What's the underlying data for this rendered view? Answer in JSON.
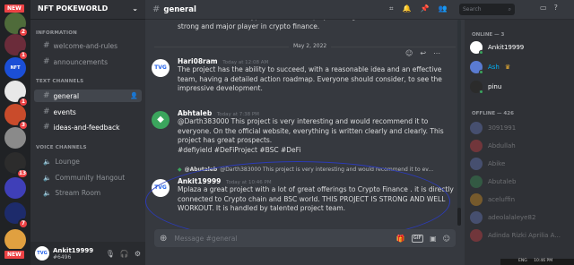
{
  "server": {
    "name": "NFT POKEWORLD",
    "rail": [
      {
        "badge": "",
        "new": true
      },
      {
        "badge": "2"
      },
      {
        "badge": "1"
      },
      {
        "badge": ""
      },
      {
        "badge": "1"
      },
      {
        "badge": "3"
      },
      {
        "badge": ""
      },
      {
        "badge": "13"
      },
      {
        "badge": ""
      },
      {
        "badge": "7"
      },
      {
        "badge": "",
        "new": true
      }
    ]
  },
  "sidebar": {
    "categories": {
      "information": "INFORMATION",
      "text": "TEXT CHANNELS",
      "voice": "VOICE CHANNELS"
    },
    "info_channels": [
      "welcome-and-rules",
      "announcements"
    ],
    "text_channels": [
      "general",
      "events",
      "ideas-and-feedback"
    ],
    "voice_channels": [
      "Lounge",
      "Community Hangout",
      "Stream Room"
    ]
  },
  "user": {
    "name": "Ankit19999",
    "tag": "#6496"
  },
  "header": {
    "channel": "general",
    "search_placeholder": "Search"
  },
  "messages": {
    "top_continuation": "will achieve a lot in crypto finance. This project will go on farther and will be a strong and major player in crypto finance.",
    "date_divider": "May 2, 2022",
    "m1": {
      "author": "Hari08ram",
      "time": "Today at 12:08 AM",
      "text": "The project has the ability to succeed, with a reasonable idea and an effective team, having a detailed action roadmap. Everyone should consider, to see the impressive development."
    },
    "m2": {
      "author": "Abhtaleb",
      "time": "Today at 7:38 PM",
      "text": "@Darth383000 This project is very interesting and would recommend it to everyone. On the official website, everything is written clearly and clearly. This project has great prospects.",
      "tags": "#defiyield #DeFiProject #BSC #DeFi"
    },
    "reply_ref": {
      "author": "@Abutaleb",
      "text": "@Darth383000 This project is very interesting and would recommend it to ev..."
    },
    "m3": {
      "author": "Ankit19999",
      "time": "Today at 10:46 PM",
      "text": "Mplaza  a great project with a lot of great offerings to Crypto Finance . it is directly connected to Crypto chain and BSC world. THIS PROJECT IS STRONG AND WELL WORKOUT. It is handled by talented project team."
    }
  },
  "composer": {
    "placeholder": "Message #general",
    "gif": "GIF"
  },
  "members": {
    "online_header": "ONLINE — 3",
    "online": [
      "Ankit19999",
      "Ash",
      "pinu"
    ],
    "offline_header": "OFFLINE — 426",
    "offline": [
      "3091991",
      "Abdullah",
      "Abike",
      "Abutaleb",
      "aceluffin",
      "adeolalaleye82",
      "Adinda Rizki Aprilia A..."
    ]
  },
  "taskbar": {
    "lang": "ENG",
    "clock": "10:46 PM"
  },
  "colors": {
    "accent": "#5865f2",
    "online": "#3ba55d",
    "badge": "#ed4245",
    "mention_ring": "#2c3bb8"
  }
}
